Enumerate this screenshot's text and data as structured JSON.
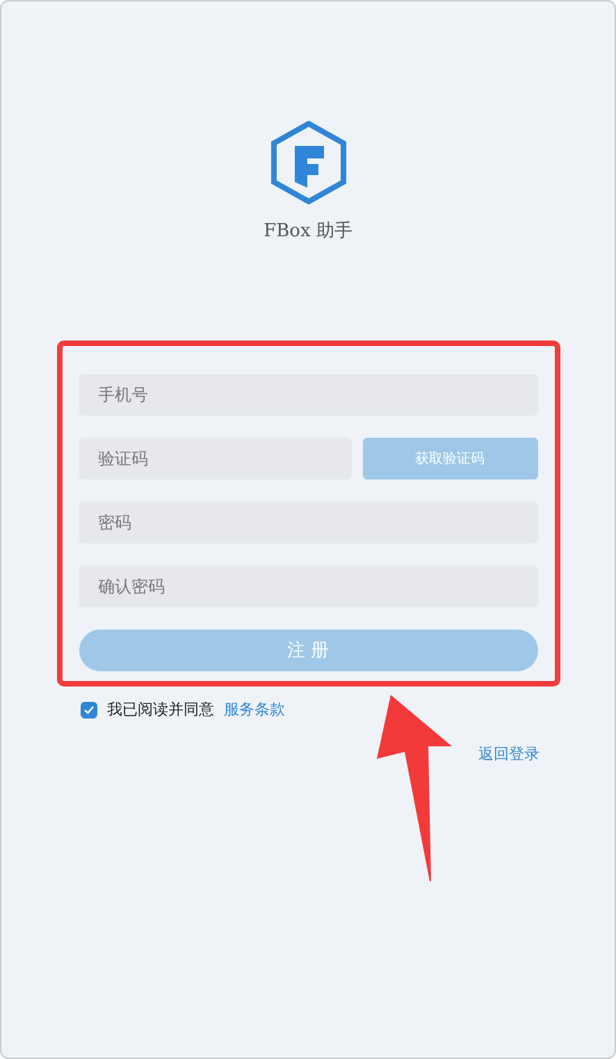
{
  "app": {
    "name": "FBox 助手"
  },
  "fields": [
    {
      "placeholder": "手机号"
    },
    {
      "placeholder": "验证码"
    },
    {
      "placeholder": "密码"
    },
    {
      "placeholder": "确认密码"
    }
  ],
  "code_button": "获取验证码",
  "register_button": "注 册",
  "agreement": {
    "checked": true,
    "text": "我已阅读并同意",
    "link": "服务条款"
  },
  "back_link": "返回登录"
}
